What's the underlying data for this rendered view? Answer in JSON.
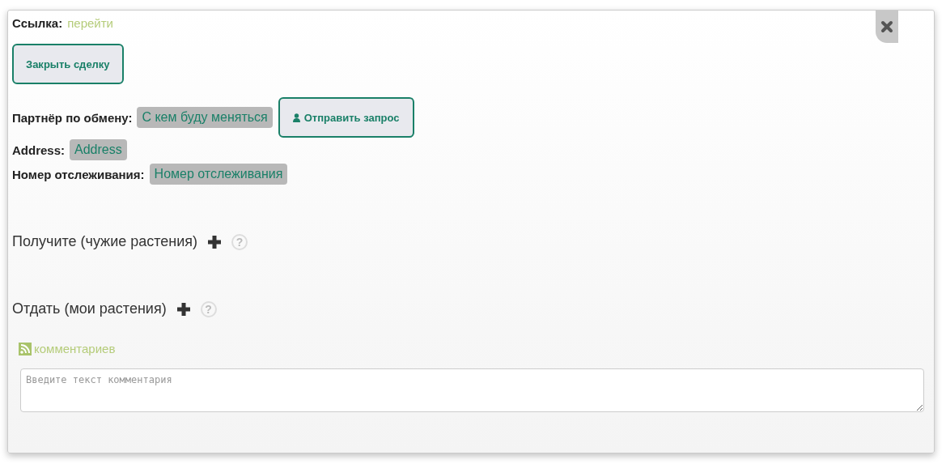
{
  "link": {
    "label": "Ссылка:",
    "text": "перейти"
  },
  "close_deal_button": "Закрыть сделку",
  "fields": [
    {
      "label": "Партнёр по обмену:",
      "value": "С кем буду меняться",
      "action": "Отправить запрос"
    },
    {
      "label": "Address:",
      "value": "Address"
    },
    {
      "label": "Номер отслеживания:",
      "value": "Номер отслеживания"
    }
  ],
  "sections": [
    {
      "title": "Получите (чужие растения)",
      "help": "?"
    },
    {
      "title": "Отдать (мои растения)",
      "help": "?"
    }
  ],
  "comments": {
    "feed_link": "комментариев",
    "placeholder": "Введите текст комментария"
  }
}
